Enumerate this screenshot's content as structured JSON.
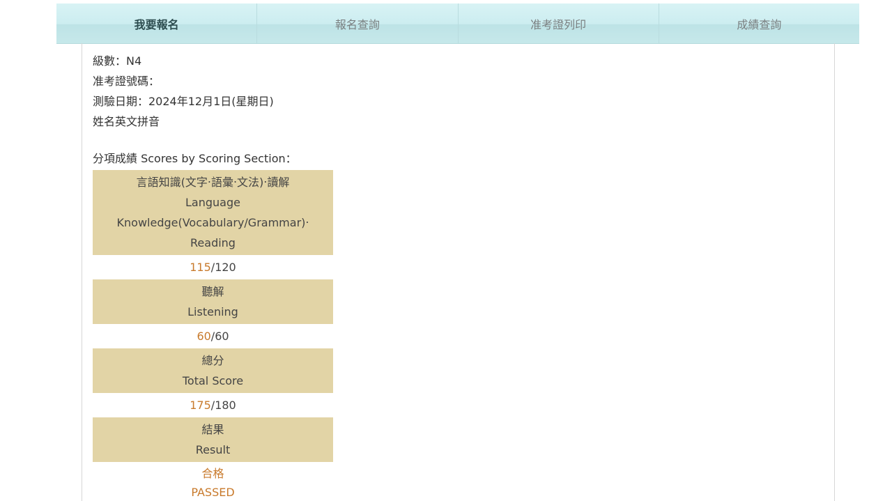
{
  "tabs": [
    {
      "label": "我要報名",
      "active": true
    },
    {
      "label": "報名查詢",
      "active": false
    },
    {
      "label": "准考證列印",
      "active": false
    },
    {
      "label": "成績查詢",
      "active": false
    }
  ],
  "info": {
    "level": "級數：N4",
    "ticket_number": "准考證號碼：",
    "test_date": "測驗日期：2024年12月1日(星期日)",
    "name_romaji": "姓名英文拼音"
  },
  "scores_title": "分項成績 Scores by Scoring Section：",
  "sections": [
    {
      "zh": "言語知識(文字‧語彙‧文法)‧讀解",
      "en": "Language Knowledge(Vocabulary/Grammar)‧ Reading",
      "score": "115",
      "max": "/120"
    },
    {
      "zh": "聽解",
      "en": "Listening",
      "score": "60",
      "max": "/60"
    },
    {
      "zh": "總分",
      "en": "Total Score",
      "score": "175",
      "max": "/180"
    }
  ],
  "result": {
    "zh": "結果",
    "en": "Result",
    "value_zh": "合格",
    "value_en": "PASSED"
  },
  "colors": {
    "tab_bg": "#ccedf0",
    "header_cell_bg": "#e2d4a6",
    "score_accent": "#c87a2c"
  }
}
